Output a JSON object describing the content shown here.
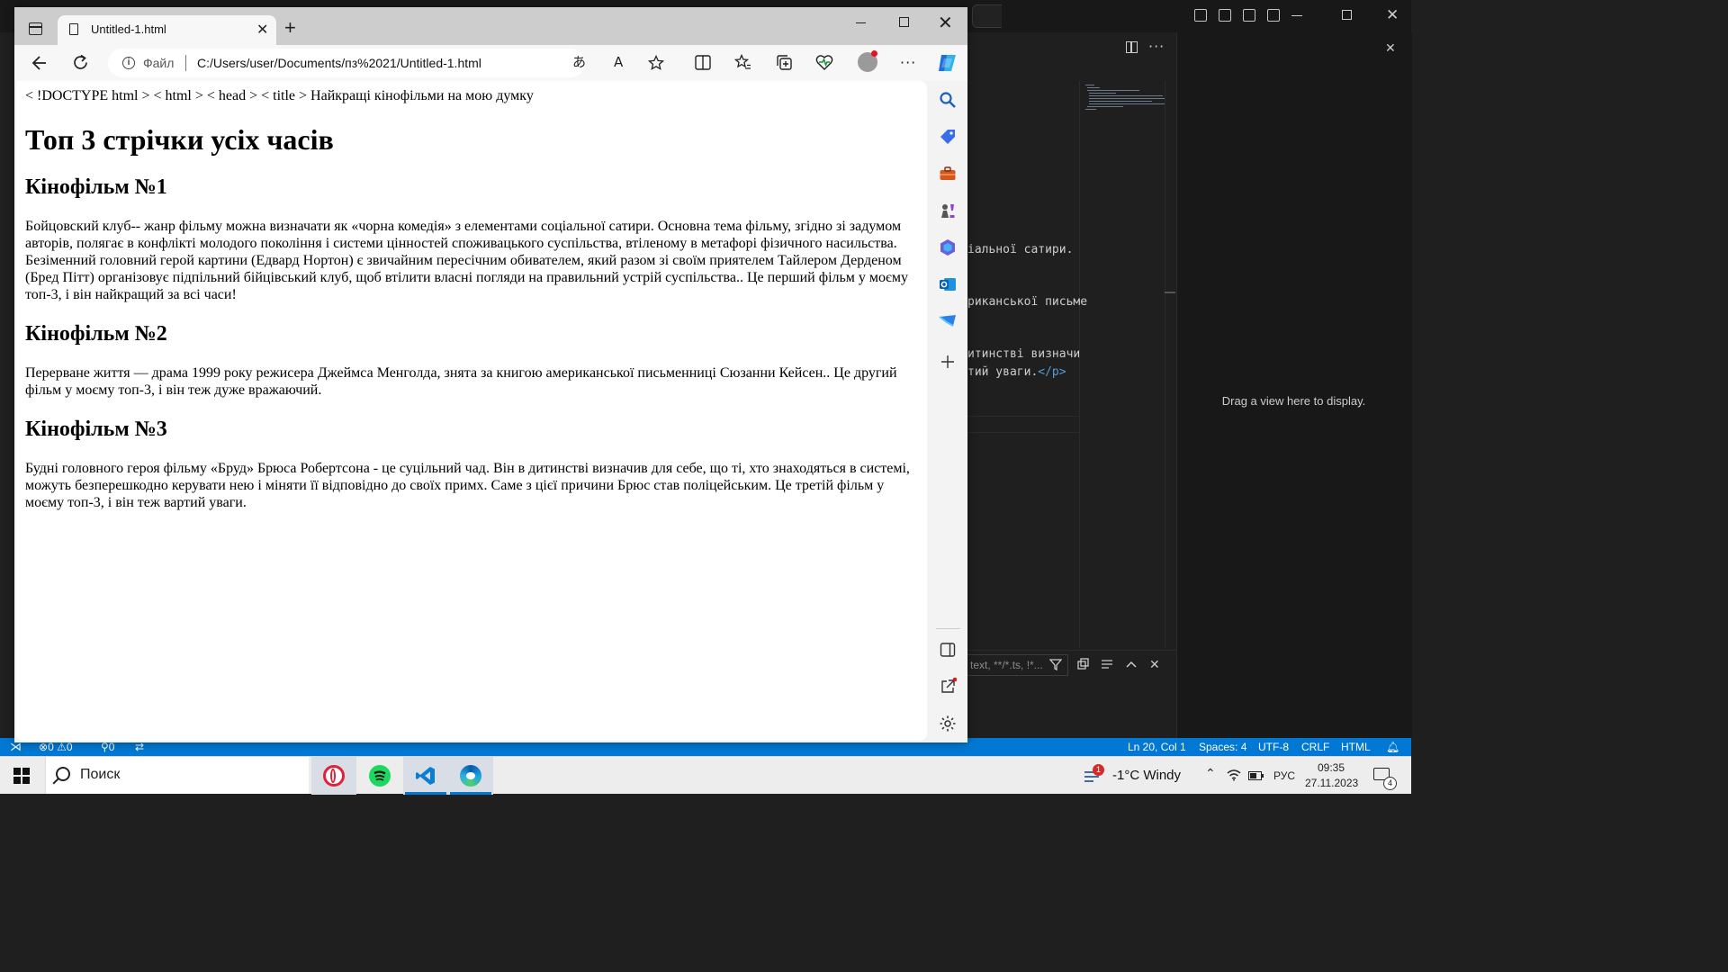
{
  "browser": {
    "tab_title": "Untitled-1.html",
    "address_scheme": "Файл",
    "address_url": "C:/Users/user/Documents/пз%2021/Untitled-1.html"
  },
  "page": {
    "raw_head": "< !DOCTYPE html > < html > < head > < title > Найкращі кінофільми на мою думку",
    "heading": "Топ 3 стрічки усіх часів",
    "sections": [
      {
        "title": "Кінофільм №1",
        "text": "Бойцовский клуб-- жанр фільму можна визначати як «чорна комедія» з елементами соціальної сатири. Основна тема фільму, згідно зі задумом авторів, полягає в конфлікті молодого покоління і системи цінностей споживацького суспільства, втіленому в метафорі фізичного насильства. Безіменний головний герой картини (Едвард Нортон) є звичайним пересічним обивателем, який разом зі своїм приятелем Тайлером Дерденом (Бред Пітт) організовує підпільний бійцівський клуб, щоб втілити власні погляди на правильний устрій суспільства.. Це перший фільм у моєму топ-3, і він найкращий за всі часи!"
      },
      {
        "title": "Кінофільм №2",
        "text": "Перерване життя — драма 1999 року режисера Джеймса Менголда, знята за книгою американської письменниці Сюзанни Кейсен.. Це другий фільм у моєму топ-3, і він теж дуже вражаючий."
      },
      {
        "title": "Кінофільм №3",
        "text": "Будні головного героя фільму «Бруд» Брюса Робертсона - це суцільний чад. Він в дитинстві визначив для себе, що ті, хто знаходяться в системі, можуть безперешкодно керувати нею і міняти її відповідно до своїх примх. Саме з цієї причини Брюс став поліцейським. Це третій фільм у моєму топ-3, і він теж вартий уваги."
      }
    ]
  },
  "vscode": {
    "code_fragments": [
      "іальної сатири.",
      "риканської письме",
      "итинстві визначи",
      "тий уваги.",
      "</p>"
    ],
    "right_panel_text": "Drag a view here to display.",
    "find_placeholder": "text, **/*.ts, !*...",
    "status": {
      "errors": "0",
      "warnings": "0",
      "ports": "0",
      "position": "Ln 20, Col 1",
      "spaces": "Spaces: 4",
      "encoding": "UTF-8",
      "eol": "CRLF",
      "language": "HTML"
    }
  },
  "taskbar": {
    "search_label": "Поиск",
    "weather_badge": "1",
    "weather": "-1°C  Windy",
    "language": "РУС",
    "time": "09:35",
    "date": "27.11.2023",
    "notification_count": "4",
    "apps": [
      "opera-icon",
      "spotify-icon",
      "vscode-icon",
      "edge-icon"
    ]
  },
  "colors": {
    "vscode_status": "#0078d4",
    "edge_tabstrip": "#cdcdcd"
  }
}
